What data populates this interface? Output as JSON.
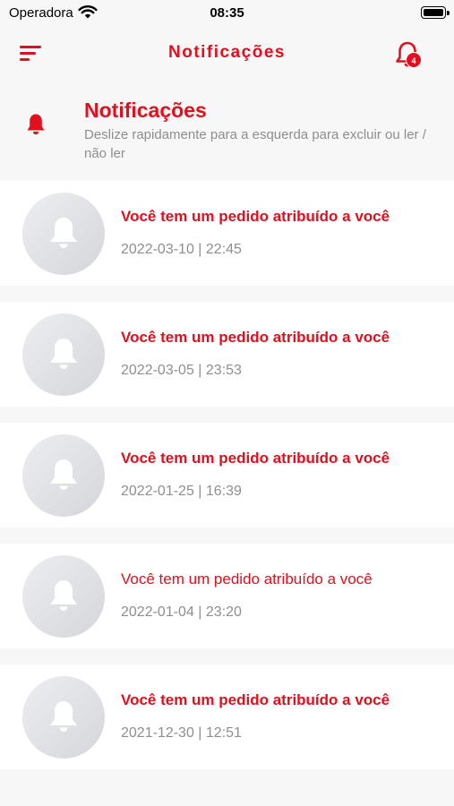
{
  "status_bar": {
    "carrier": "Operadora",
    "time": "08:35"
  },
  "nav": {
    "title": "Notificações",
    "badge_count": "4"
  },
  "header": {
    "title": "Notificações",
    "subtitle": "Deslize rapidamente para a esquerda para excluir ou ler / não ler"
  },
  "notifications": [
    {
      "title": "Você tem um pedido atribuído a você",
      "date": "2022-03-10 | 22:45",
      "read": false
    },
    {
      "title": "Você tem um pedido atribuído a você",
      "date": "2022-03-05 | 23:53",
      "read": false
    },
    {
      "title": "Você tem um pedido atribuído a você",
      "date": "2022-01-25 | 16:39",
      "read": false
    },
    {
      "title": "Você tem um pedido atribuído a você",
      "date": "2022-01-04 | 23:20",
      "read": true
    },
    {
      "title": "Você tem um pedido atribuído a você",
      "date": "2021-12-30 | 12:51",
      "read": false
    }
  ],
  "icons": {
    "menu": "hamburger-menu-icon",
    "bell": "bell-icon",
    "wifi": "wifi-icon",
    "battery": "battery-icon"
  },
  "colors": {
    "accent": "#e1101f",
    "background": "#f7f7f7",
    "muted": "#8e8e93"
  }
}
